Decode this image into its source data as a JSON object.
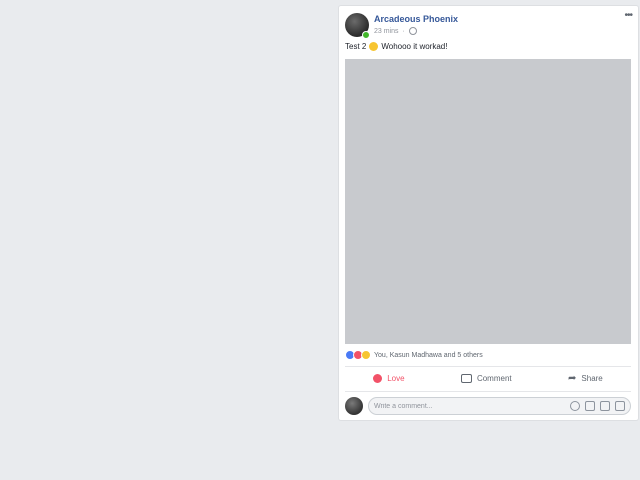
{
  "post": {
    "author": "Arcadeous Phoenix",
    "time": "23 mins",
    "privacy_icon": "globe-icon",
    "more_label": "•••",
    "text_before": "Test 2",
    "emoji": "grinning-face",
    "text_after": "Wohooo it workad!",
    "media_color": "#c8cace"
  },
  "reactions": {
    "types": [
      "like",
      "love",
      "wow"
    ],
    "summary": "You, Kasun Madhawa and 5 others"
  },
  "actions": {
    "love_label": "Love",
    "comment_label": "Comment",
    "share_label": "Share",
    "share_icon": "➦"
  },
  "composer": {
    "placeholder": "Write a comment...",
    "icons": [
      "emoji-icon",
      "camera-icon",
      "gif-icon",
      "sticker-icon"
    ]
  },
  "colors": {
    "background": "#e9ebee",
    "link": "#365899",
    "love": "#f25268",
    "like": "#4a7af5",
    "muted": "#606770"
  }
}
